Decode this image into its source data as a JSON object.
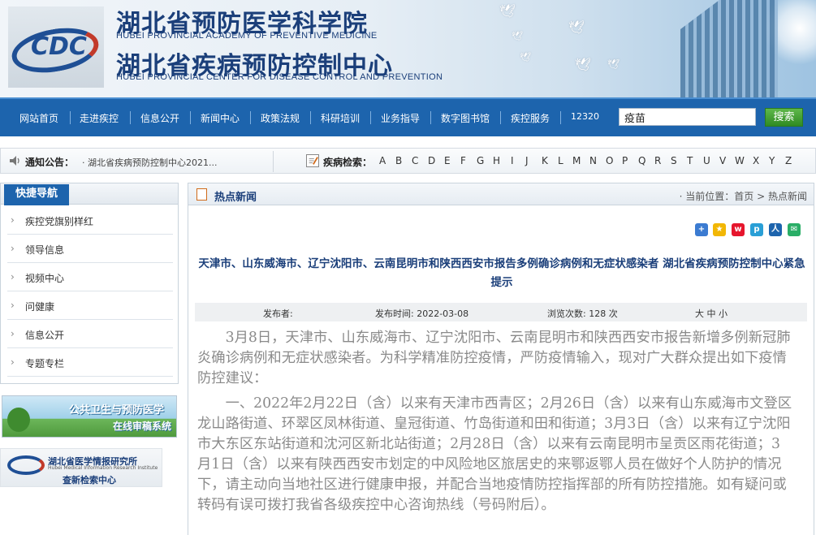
{
  "header": {
    "title_cn_1": "湖北省预防医学科学院",
    "title_en_1": "HUBEI PROVINCIAL ACADEMY OF PREVENTIVE MEDICINE",
    "title_cn_2": "湖北省疾病预防控制中心",
    "title_en_2": "HUBEI PROVINCIAL CENTER FOR DISEASE CONTROL AND PREVENTION",
    "logo_text": "CDC"
  },
  "nav": {
    "items": [
      "网站首页",
      "走进疾控",
      "信息公开",
      "新闻中心",
      "政策法规",
      "科研培训",
      "业务指导",
      "数字图书馆",
      "疾控服务",
      "12320"
    ]
  },
  "search": {
    "value": "疫苗",
    "button": "搜索"
  },
  "notice": {
    "label": "通知公告：",
    "text": "· 湖北省疾病预防控制中心2021..."
  },
  "disease": {
    "label": "疾病检索：",
    "letters": [
      "A",
      "B",
      "C",
      "D",
      "E",
      "F",
      "G",
      "H",
      "I",
      "J",
      "K",
      "L",
      "M",
      "N",
      "O",
      "P",
      "Q",
      "R",
      "S",
      "T",
      "U",
      "V",
      "W",
      "X",
      "Y",
      "Z"
    ]
  },
  "sidebar": {
    "title": "快捷导航",
    "items": [
      "疾控党旗别样红",
      "领导信息",
      "视频中心",
      "问健康",
      "信息公开",
      "专题专栏"
    ]
  },
  "banners": {
    "b1_line1": "公共卫生与预防医学",
    "b1_line2": "在线审稿系统",
    "b2_line1": "湖北省医学情报研究所",
    "b2_line2": "Hubei Medical Information Research Institute",
    "b2_line3": "查新检索中心"
  },
  "main": {
    "section_title": "热点新闻",
    "breadcrumb": "· 当前位置：首页 > 热点新闻",
    "headline": "天津市、山东威海市、辽宁沈阳市、云南昆明市和陕西西安市报告多例确诊病例和无症状感染者 湖北省疾病预防控制中心紧急提示",
    "meta": {
      "publisher": "发布者:",
      "time": "发布时间: 2022-03-08",
      "views": "浏览次数: 128 次",
      "size": "大 中 小"
    },
    "paragraphs": [
      "3月8日，天津市、山东威海市、辽宁沈阳市、云南昆明市和陕西西安市报告新增多例新冠肺炎确诊病例和无症状感染者。为科学精准防控疫情，严防疫情输入，现对广大群众提出如下疫情防控建议：",
      "一、2022年2月22日（含）以来有天津市西青区；2月26日（含）以来有山东威海市文登区龙山路街道、环翠区凤林街道、皇冠街道、竹岛街道和田和街道；3月3日（含）以来有辽宁沈阳市大东区东站街道和沈河区新北站街道；2月28日（含）以来有云南昆明市呈贡区雨花街道；3月1日（含）以来有陕西西安市划定的中风险地区旅居史的来鄂返鄂人员在做好个人防护的情况下，请主动向当地社区进行健康申报，并配合当地疫情防控指挥部的所有防控措施。如有疑问或转码有误可拨打我省各级疾控中心咨询热线（号码附后）。"
    ]
  },
  "share_icons": [
    "plus-icon",
    "qzone-icon",
    "weibo-icon",
    "pengyou-icon",
    "renren-icon",
    "wechat-icon"
  ],
  "colors": {
    "nav_blue": "#1d64ad",
    "title_blue": "#1b3f7a",
    "search_green": "#2f8a23"
  }
}
